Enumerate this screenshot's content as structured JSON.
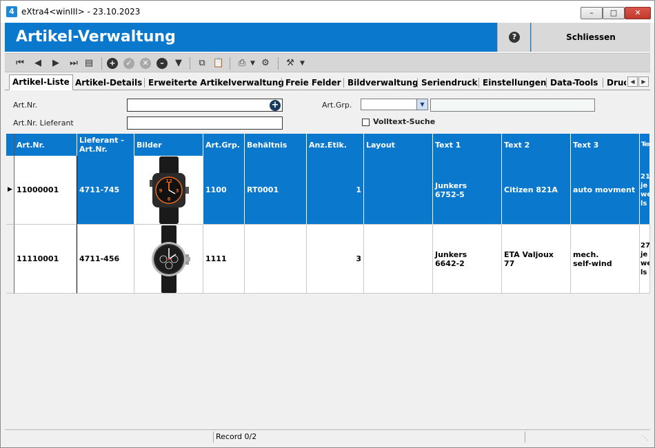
{
  "window": {
    "title": "eXtra4<winIII>  -  23.10.2023",
    "icon_text": "4",
    "controls": [
      "minimize",
      "maximize",
      "close"
    ]
  },
  "header": {
    "title": "Artikel-Verwaltung",
    "help_label": "?",
    "close_label": "Schliessen",
    "accent_color": "#0a78cc"
  },
  "toolbar": {
    "buttons": [
      "first-record-icon",
      "previous-record-icon",
      "next-record-icon",
      "last-record-icon",
      "list-view-icon",
      "add-icon",
      "confirm-icon",
      "cancel-icon",
      "delete-icon",
      "filter-icon",
      "copy-icon",
      "paste-icon",
      "print-icon",
      "print-settings-icon",
      "tools-icon"
    ]
  },
  "tabs": [
    {
      "label": "Artikel-Liste",
      "active": true
    },
    {
      "label": "Artikel-Details",
      "active": false
    },
    {
      "label": "Erweiterte Artikelverwaltung",
      "active": false
    },
    {
      "label": "Freie Felder",
      "active": false
    },
    {
      "label": "Bildverwaltung",
      "active": false
    },
    {
      "label": "Seriendruck",
      "active": false
    },
    {
      "label": "Einstellungen",
      "active": false
    },
    {
      "label": "Data-Tools",
      "active": false
    },
    {
      "label": "Druc",
      "active": false
    }
  ],
  "search": {
    "art_nr_label": "Art.Nr.",
    "art_nr_value": "",
    "art_nr_lieferant_label": "Art.Nr. Lieferant",
    "art_nr_lieferant_value": "",
    "art_grp_label": "Art.Grp.",
    "art_grp_value": "",
    "volltext_label": "Volltext-Suche",
    "volltext_checked": false
  },
  "grid": {
    "columns": [
      "Art.Nr.",
      "Lieferant - Art.Nr.",
      "Bilder",
      "Art.Grp.",
      "Behältnis",
      "Anz.Etik.",
      "Layout",
      "Text 1",
      "Text 2",
      "Text 3",
      "Text"
    ],
    "rows": [
      {
        "selected": true,
        "art_nr": "11000001",
        "lieferant_art_nr": "4711-745",
        "image": "watch-black-orange",
        "art_grp": "1100",
        "behaeltnis": "RT0001",
        "anz_etik": "1",
        "layout": "",
        "text1": "Junkers\n6752-5",
        "text2": "Citizen 821A",
        "text3": "auto movment",
        "text4": "21\nje\nwe\nls"
      },
      {
        "selected": false,
        "art_nr": "11110001",
        "lieferant_art_nr": "4711-456",
        "image": "watch-chronograph",
        "art_grp": "1111",
        "behaeltnis": "",
        "anz_etik": "3",
        "layout": "",
        "text1": "Junkers\n6642-2",
        "text2": "ETA Valjoux\n77",
        "text3": "mech.\nself-wind",
        "text4": "27\nje\nwe\nls"
      }
    ]
  },
  "status": {
    "record_text": "Record 0/2"
  }
}
